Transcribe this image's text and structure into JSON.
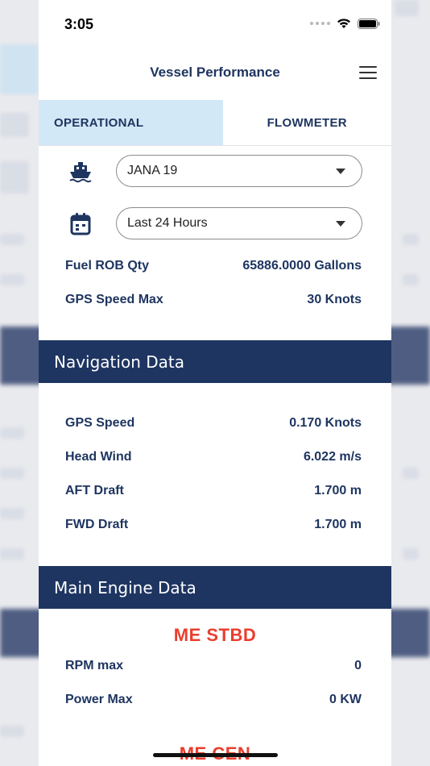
{
  "status_bar": {
    "time": "3:05"
  },
  "header": {
    "title": "Vessel Performance",
    "menu_icon": "hamburger-menu-icon"
  },
  "tabs": [
    {
      "label": "OPERATIONAL",
      "active": true
    },
    {
      "label": "FLOWMETER",
      "active": false
    }
  ],
  "filters": {
    "vessel": {
      "icon": "ship-icon",
      "value": "JANA 19"
    },
    "period": {
      "icon": "calendar-icon",
      "value": "Last 24 Hours"
    }
  },
  "summary": [
    {
      "label": "Fuel ROB Qty",
      "value": "65886.0000 Gallons"
    },
    {
      "label": "GPS Speed Max",
      "value": "30 Knots"
    }
  ],
  "navigation_data": {
    "title": "Navigation Data",
    "rows": [
      {
        "label": "GPS Speed",
        "value": "0.170 Knots"
      },
      {
        "label": "Head Wind",
        "value": "6.022 m/s"
      },
      {
        "label": "AFT Draft",
        "value": "1.700 m"
      },
      {
        "label": "FWD Draft",
        "value": "1.700 m"
      }
    ]
  },
  "main_engine_data": {
    "title": "Main Engine Data",
    "engines": [
      {
        "name": "ME STBD",
        "rows": [
          {
            "label": "RPM max",
            "value": "0"
          },
          {
            "label": "Power Max",
            "value": "0 KW"
          }
        ]
      },
      {
        "name": "ME CEN"
      }
    ]
  },
  "colors": {
    "brand_navy": "#1e3562",
    "tab_active_bg": "#d3e8f6",
    "engine_title_red": "#ea3e2e"
  }
}
